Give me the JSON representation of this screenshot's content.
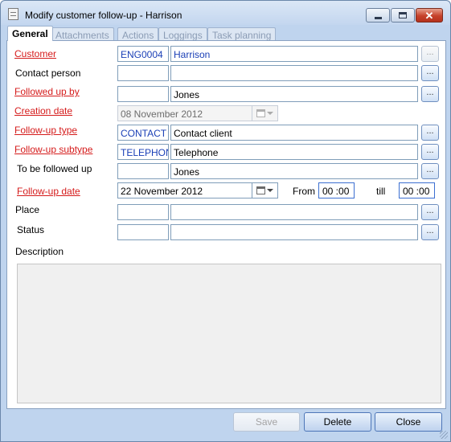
{
  "window": {
    "title": "Modify customer follow-up - Harrison",
    "close_glyph": "✕"
  },
  "tabs": [
    {
      "label": "General"
    },
    {
      "label": "Attachments"
    },
    {
      "label": "Actions"
    },
    {
      "label": "Loggings"
    },
    {
      "label": "Task planning"
    }
  ],
  "form": {
    "customer": {
      "label": "Customer",
      "code": "ENG0004",
      "name": "Harrison"
    },
    "contact_person": {
      "label": "Contact person",
      "code": "",
      "name": ""
    },
    "followed_up_by": {
      "label": "Followed up by",
      "code": "",
      "name": "Jones"
    },
    "creation_date": {
      "label": "Creation date",
      "value": "08 November 2012"
    },
    "followup_type": {
      "label": "Follow-up type",
      "code": "CONTACT",
      "name": "Contact client"
    },
    "followup_subtype": {
      "label": "Follow-up subtype",
      "code": "TELEPHON",
      "name": "Telephone"
    },
    "to_be_followed_up": {
      "label": "To be followed up",
      "code": "",
      "name": "Jones"
    },
    "followup_date": {
      "label": "Follow-up date",
      "value": "22 November 2012"
    },
    "from": {
      "label": "From",
      "value": "00 :00"
    },
    "till": {
      "label": "till",
      "value": "00 :00"
    },
    "place": {
      "label": "Place",
      "code": "",
      "name": ""
    },
    "status": {
      "label": "Status",
      "code": "",
      "name": ""
    },
    "description": {
      "label": "Description",
      "value": ""
    }
  },
  "lookup_glyph": "...",
  "buttons": {
    "save": "Save",
    "delete": "Delete",
    "close": "Close"
  },
  "colors": {
    "required_label": "#d51b1b",
    "code_text": "#1a3fb6",
    "window_frame": "#bfd4ee"
  }
}
